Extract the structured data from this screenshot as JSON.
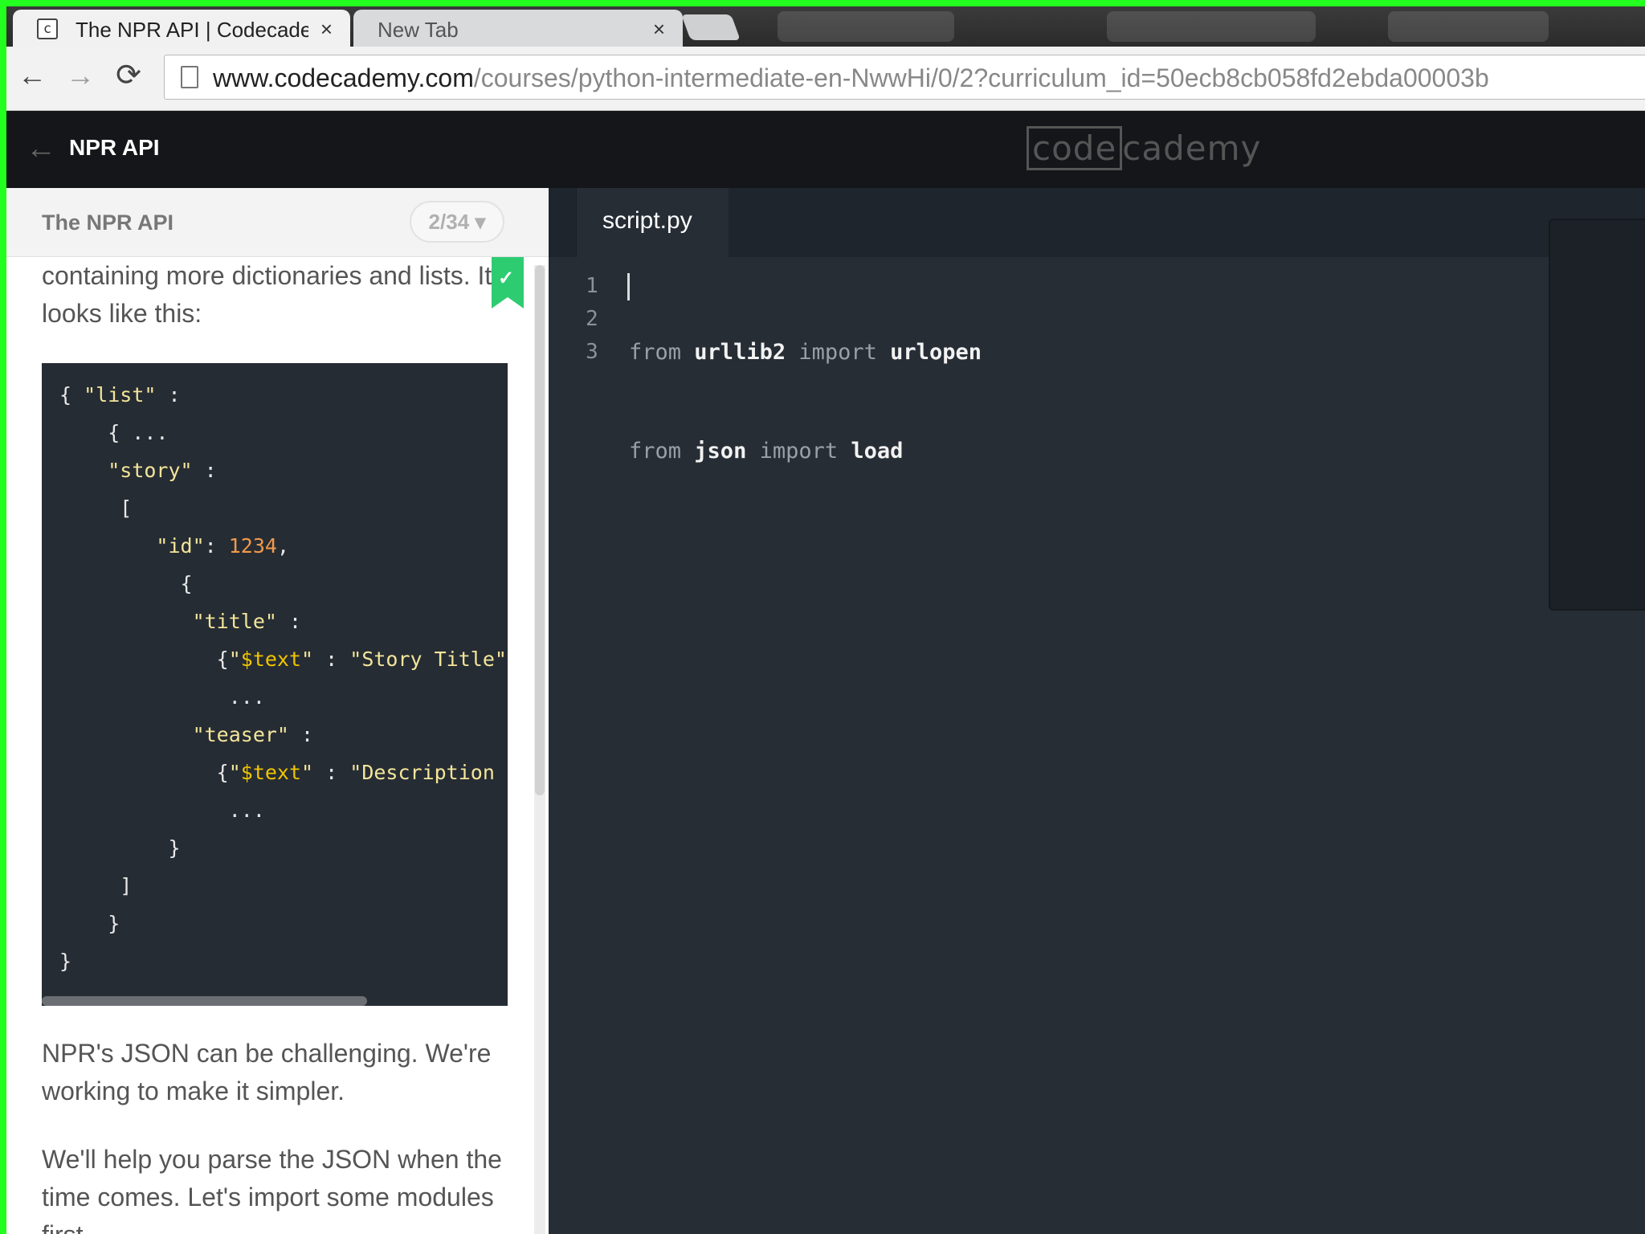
{
  "browser": {
    "tabs": [
      {
        "title": "The NPR API | Codecademy",
        "favicon": "codecademy-favicon",
        "favicon_glyph": "c",
        "active": true
      },
      {
        "title": "New Tab",
        "active": false
      }
    ],
    "close_glyph": "×",
    "nav": {
      "back_glyph": "←",
      "forward_glyph": "→",
      "reload_glyph": "⟳"
    },
    "url_host": "www.codecademy.com",
    "url_path": "/courses/python-intermediate-en-NwwHi/0/2?curriculum_id=50ecb8cb058fd2ebda00003b"
  },
  "header": {
    "back_glyph": "←",
    "course_title": "NPR API",
    "logo_left": "code",
    "logo_right": "cademy"
  },
  "lesson": {
    "title": "The NPR API",
    "progress": "2/34 ▾",
    "paragraph_top": "containing more dictionaries and lists. It looks like this:",
    "bookmark_glyph": "✓",
    "paragraph_mid": "NPR's JSON can be challenging. We're working to make it simpler.",
    "paragraph_bot": "We'll help you parse the JSON when the time comes. Let's import some modules first."
  },
  "editor": {
    "file_tab": "script.py",
    "line_numbers": [
      "1",
      "2",
      "3"
    ],
    "lines": [
      {
        "kw1": "from",
        "mod": "urllib2",
        "kw2": "import",
        "name": "urlopen"
      },
      {
        "kw1": "from",
        "mod": "json",
        "kw2": "import",
        "name": "load"
      },
      {
        "kw1": "",
        "mod": "",
        "kw2": "",
        "name": ""
      }
    ]
  },
  "colors": {
    "frame": "#23ff1e",
    "header_bg": "#141619",
    "editor_bg": "#262d35",
    "check_green": "#2ecc71"
  }
}
